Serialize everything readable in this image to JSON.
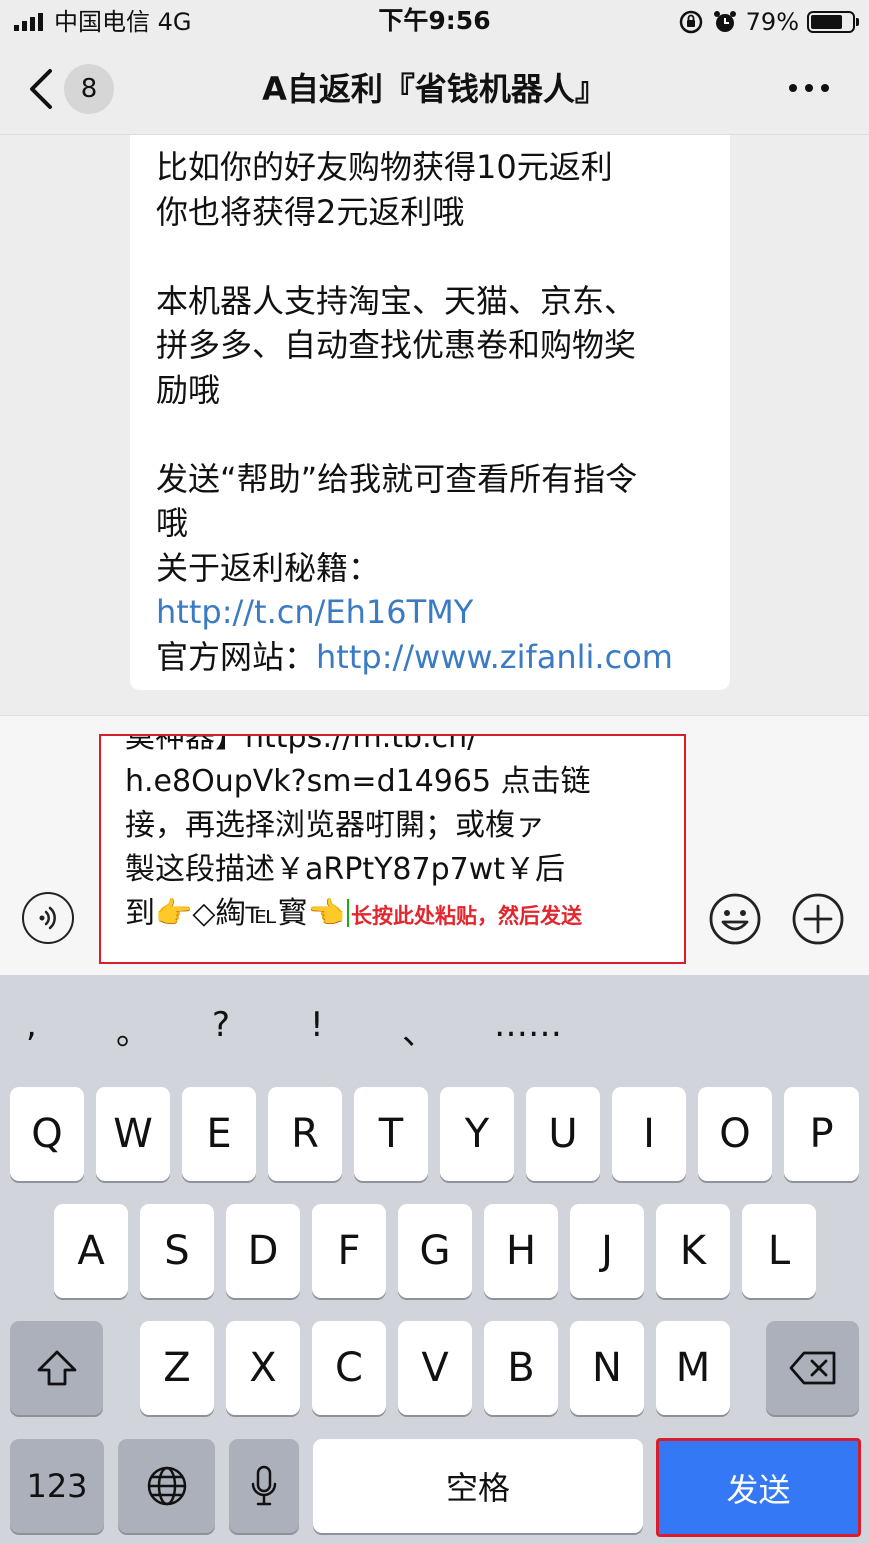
{
  "status_bar": {
    "carrier": "中国电信  4G",
    "time": "下午9:56",
    "battery": "79%",
    "battery_level": 0.79
  },
  "nav": {
    "unread_count": "8",
    "title": "A自返利『省钱机器人』",
    "icons": {
      "back": "chevron-left-icon",
      "more": "more-icon"
    }
  },
  "message": {
    "lines": [
      "比如你的好友购物获得10元返利",
      "你也将获得2元返利哦",
      "",
      "本机器人支持淘宝、天猫、京东、",
      "拼多多、自动查找优惠卷和购物奖",
      "励哦",
      "",
      "发送“帮助”给我就可查看所有指令",
      "哦",
      "关于返利秘籍："
    ],
    "secret_link": "http://t.cn/Eh16TMY",
    "website_label": "官方网站：",
    "website_link": "http://www.zifanli.com"
  },
  "input": {
    "lines": [
      "莫神器】https://m.tb.cn/",
      "h.e8OupVk?sm=d14965 点击链",
      "接，再选择浏览器咑閞；或椱ァ",
      "製这段描述￥aRPtY87p7wt￥后"
    ],
    "last_line_text": "到👉◇綯℡寳👈",
    "hint": "长按此处粘贴，然后发送",
    "icons": {
      "voice": "voice-icon",
      "emoji": "emoji-icon",
      "plus": "plus-icon"
    }
  },
  "keyboard": {
    "punctuation": [
      ",",
      "。",
      "?",
      "!",
      "、",
      "……"
    ],
    "row1": [
      "Q",
      "W",
      "E",
      "R",
      "T",
      "Y",
      "U",
      "I",
      "O",
      "P"
    ],
    "row2": [
      "A",
      "S",
      "D",
      "F",
      "G",
      "H",
      "J",
      "K",
      "L"
    ],
    "row3": [
      "Z",
      "X",
      "C",
      "V",
      "B",
      "N",
      "M"
    ],
    "numbers_key": "123",
    "space_key": "空格",
    "send_key": "发送",
    "icons": {
      "shift": "shift-icon",
      "delete": "delete-icon",
      "globe": "globe-icon",
      "mic": "microphone-icon"
    }
  }
}
